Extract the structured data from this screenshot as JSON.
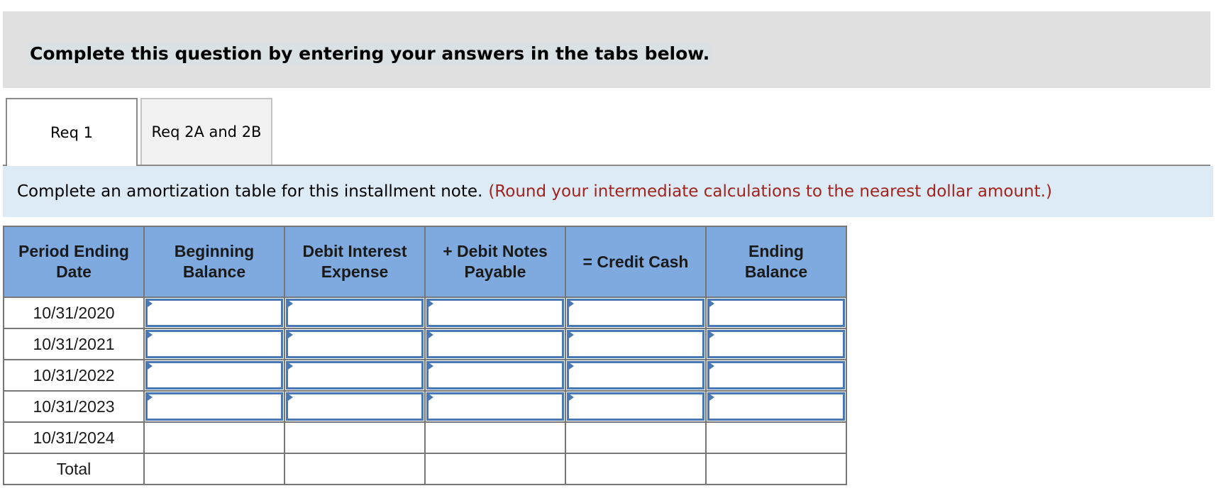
{
  "banner": {
    "text": "Complete this question by entering your answers in the tabs below."
  },
  "tabs": [
    {
      "label": "Req 1",
      "active": true
    },
    {
      "label": "Req 2A and 2B",
      "active": false
    }
  ],
  "instruction": {
    "text": "Complete an amortization table for this installment note.",
    "note": "(Round your intermediate calculations to the nearest dollar amount.)"
  },
  "table": {
    "headers": [
      "Period Ending Date",
      "Beginning Balance",
      "Debit Interest Expense",
      "+ Debit Notes Payable",
      "= Credit Cash",
      "Ending Balance"
    ],
    "rows": [
      {
        "date": "10/31/2020",
        "values": [
          "",
          "",
          "",
          "",
          ""
        ],
        "editable": true
      },
      {
        "date": "10/31/2021",
        "values": [
          "",
          "",
          "",
          "",
          ""
        ],
        "editable": true
      },
      {
        "date": "10/31/2022",
        "values": [
          "",
          "",
          "",
          "",
          ""
        ],
        "editable": true
      },
      {
        "date": "10/31/2023",
        "values": [
          "",
          "",
          "",
          "",
          ""
        ],
        "editable": true
      },
      {
        "date": "10/31/2024",
        "values": [
          "",
          "",
          "",
          "",
          ""
        ],
        "editable": false
      }
    ],
    "total": {
      "label": "Total",
      "values": [
        "",
        "",
        "",
        "",
        ""
      ]
    }
  },
  "colors": {
    "header_bg": "#7faadf",
    "input_border": "#4a78b5",
    "note_red": "#a2231d",
    "instruction_bg": "#ddebf7"
  }
}
